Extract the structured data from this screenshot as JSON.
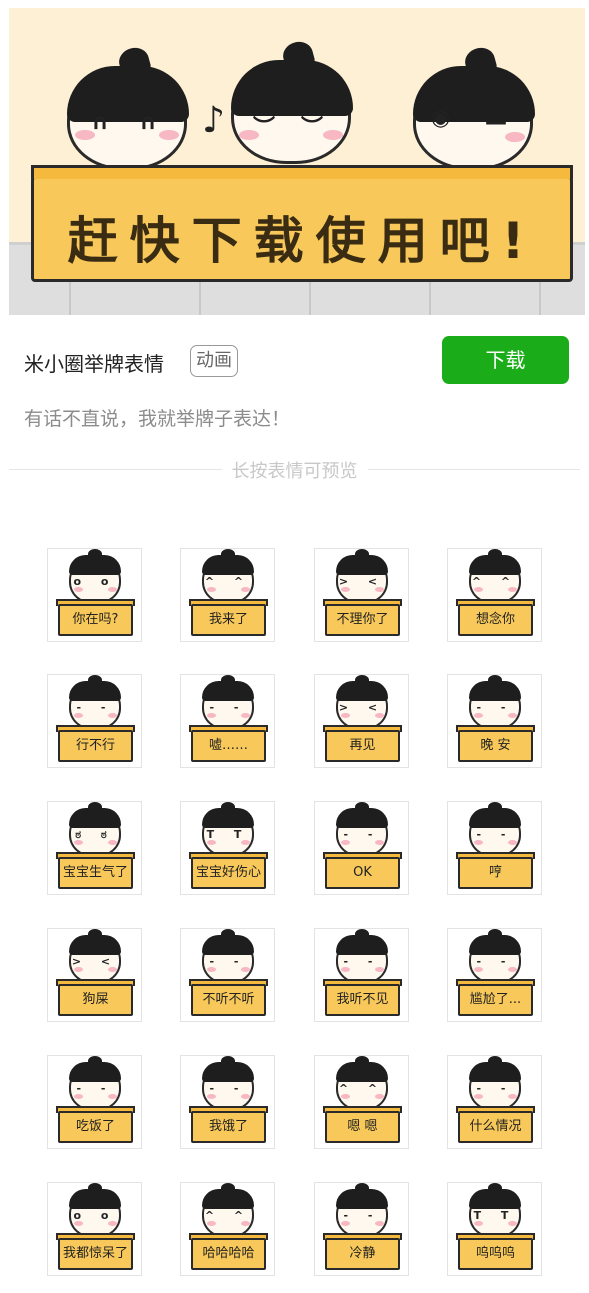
{
  "banner": {
    "board_text": "赶快下载使用吧!",
    "note_icon": "music-note-icon"
  },
  "pack": {
    "title": "米小圈举牌表情",
    "tag": "动画",
    "download_label": "下载",
    "description": "有话不直说，我就举牌子表达！"
  },
  "preview_hint": "长按表情可预览",
  "stickers": [
    {
      "label": "你在吗?"
    },
    {
      "label": "我来了"
    },
    {
      "label": "不理你了"
    },
    {
      "label": "想念你"
    },
    {
      "label": "行不行"
    },
    {
      "label": "嘘……"
    },
    {
      "label": "再见"
    },
    {
      "label": "晚 安"
    },
    {
      "label": "宝宝生气了"
    },
    {
      "label": "宝宝好伤心"
    },
    {
      "label": "OK"
    },
    {
      "label": "哼"
    },
    {
      "label": "狗屎"
    },
    {
      "label": "不听不听"
    },
    {
      "label": "我听不见"
    },
    {
      "label": "尴尬了..."
    },
    {
      "label": "吃饭了"
    },
    {
      "label": "我饿了"
    },
    {
      "label": "嗯 嗯"
    },
    {
      "label": "什么情况"
    },
    {
      "label": "我都惊呆了"
    },
    {
      "label": "哈哈哈哈"
    },
    {
      "label": "冷静"
    },
    {
      "label": "呜呜呜"
    }
  ],
  "colors": {
    "download_green": "#1aad19",
    "board_yellow": "#f8c95a",
    "banner_bg": "#fdf0d5"
  }
}
